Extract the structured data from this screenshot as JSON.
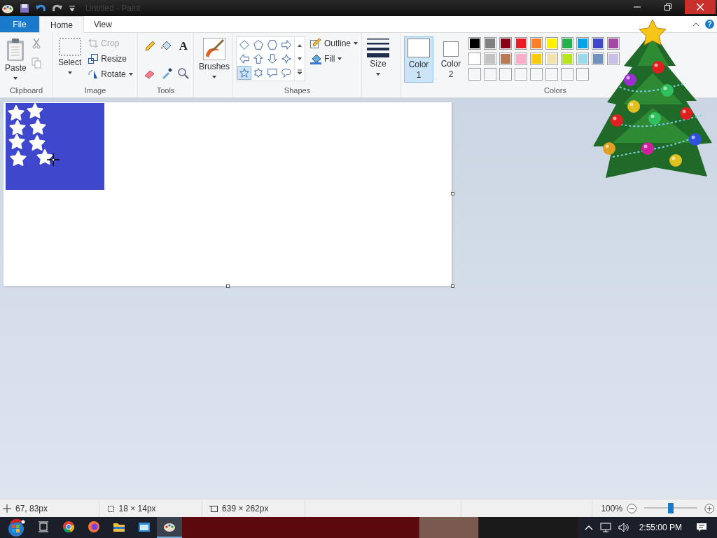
{
  "window": {
    "title": "Untitled - Paint"
  },
  "tabs": [
    {
      "label": "File",
      "kind": "file",
      "selected": false
    },
    {
      "label": "Home",
      "kind": "tab",
      "selected": true
    },
    {
      "label": "View",
      "kind": "tab",
      "selected": false
    }
  ],
  "help": "?",
  "clipboard": {
    "paste": "Paste",
    "label": "Clipboard"
  },
  "image": {
    "select": "Select",
    "crop": "Crop",
    "crop_disabled": true,
    "resize": "Resize",
    "rotate": "Rotate",
    "label": "Image"
  },
  "tools": {
    "label": "Tools",
    "text_tool": "A"
  },
  "brushes": {
    "label": "Brushes"
  },
  "shapes": {
    "label": "Shapes",
    "outline": "Outline",
    "fill": "Fill",
    "items": [
      {
        "kind": "diamond",
        "selected": false
      },
      {
        "kind": "pentagon",
        "selected": false
      },
      {
        "kind": "hexagon",
        "selected": false
      },
      {
        "kind": "right-arrow",
        "selected": false
      },
      {
        "kind": "left-arrow",
        "selected": false
      },
      {
        "kind": "up-arrow",
        "selected": false
      },
      {
        "kind": "down-arrow",
        "selected": false
      },
      {
        "kind": "four-star",
        "selected": false
      },
      {
        "kind": "five-star",
        "selected": true
      },
      {
        "kind": "six-star",
        "selected": false
      },
      {
        "kind": "rect-callout",
        "selected": false
      },
      {
        "kind": "oval-callout",
        "selected": false
      }
    ]
  },
  "size": {
    "label": "Size"
  },
  "colors": {
    "label": "Colors",
    "color_1": {
      "label": "Color",
      "number": "1",
      "color": "#ffffff",
      "selected": true
    },
    "color_2": {
      "label": "Color",
      "number": "2",
      "color": "#ffffff",
      "selected": false
    },
    "palette": [
      {
        "color": "#000000"
      },
      {
        "color": "#7f7f7f"
      },
      {
        "color": "#880015"
      },
      {
        "color": "#ed1c24"
      },
      {
        "color": "#ff7f27"
      },
      {
        "color": "#fff200"
      },
      {
        "color": "#22b14c"
      },
      {
        "color": "#00a2e8"
      },
      {
        "color": "#3f48cc"
      },
      {
        "color": "#a349a4"
      },
      {
        "color": "#ffffff"
      },
      {
        "color": "#c3c3c3"
      },
      {
        "color": "#b97a57"
      },
      {
        "color": "#ffaec9"
      },
      {
        "color": "#ffc90e"
      },
      {
        "color": "#efe4b0"
      },
      {
        "color": "#b5e61d"
      },
      {
        "color": "#99d9ea"
      },
      {
        "color": "#7092be"
      },
      {
        "color": "#c8bfe7"
      }
    ]
  },
  "status_bar": {
    "cursor": "67, 83px",
    "selection": "18 × 14px",
    "image_size": "639 × 262px",
    "zoom": "100%",
    "zoom_slider": {
      "level": 0.5
    }
  },
  "taskbar": {
    "apps": [
      {
        "kind": "task-view",
        "selected": false
      },
      {
        "kind": "chrome",
        "selected": false
      },
      {
        "kind": "firefox",
        "selected": false
      },
      {
        "kind": "folder",
        "selected": false
      },
      {
        "kind": "window",
        "selected": false
      },
      {
        "kind": "paint",
        "selected": true
      }
    ],
    "time": "2:55:00 PM"
  }
}
